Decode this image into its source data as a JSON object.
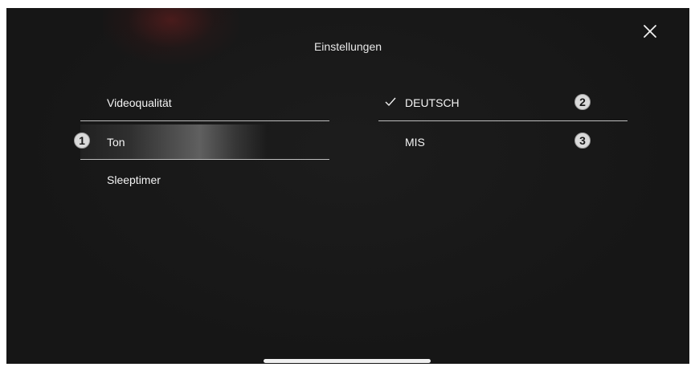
{
  "dialog": {
    "title": "Einstellungen",
    "close_icon": "close-icon"
  },
  "menu": {
    "items": [
      {
        "label": "Videoqualität",
        "selected": false
      },
      {
        "label": "Ton",
        "selected": true
      },
      {
        "label": "Sleeptimer",
        "selected": false
      }
    ]
  },
  "audio_options": {
    "items": [
      {
        "label": "DEUTSCH",
        "checked": true
      },
      {
        "label": "MIS",
        "checked": false
      }
    ]
  },
  "callouts": [
    "1",
    "2",
    "3"
  ],
  "colors": {
    "background": "#161616",
    "text": "#f2f2f2",
    "divider": "#bdbdbd",
    "badge": "#d9d9d9"
  }
}
